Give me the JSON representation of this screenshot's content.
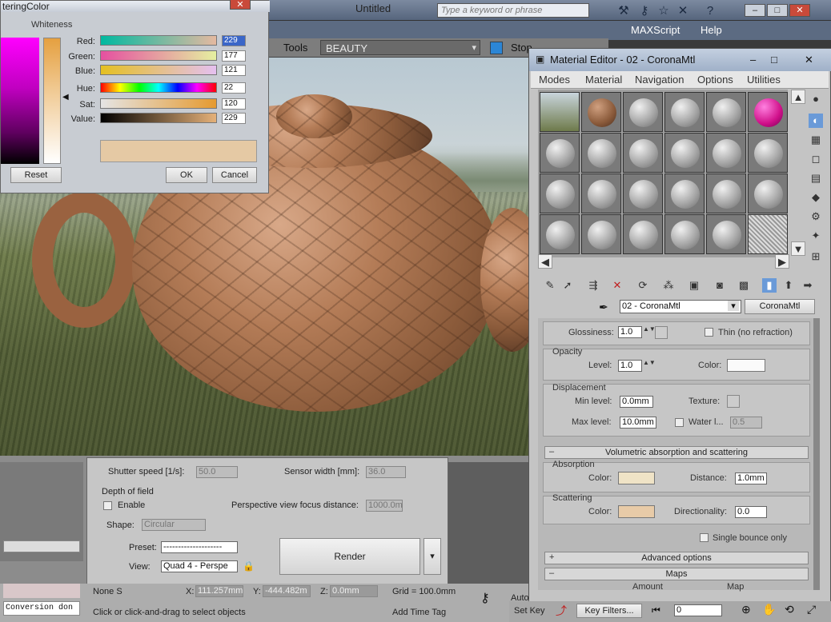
{
  "top": {
    "title": "Untitled",
    "search_placeholder": "Type a keyword or phrase",
    "menu": [
      "MAXScript",
      "Help"
    ]
  },
  "render_window": {
    "tools_label": "Tools",
    "channel": "BEAUTY",
    "stop_label": "Stop",
    "render_label": "Render"
  },
  "color_picker": {
    "title": "teringColor",
    "whiteness_label": "Whiteness",
    "rows": [
      {
        "label": "Red:",
        "value": "229"
      },
      {
        "label": "Green:",
        "value": "177"
      },
      {
        "label": "Blue:",
        "value": "121"
      },
      {
        "label": "Hue:",
        "value": "22"
      },
      {
        "label": "Sat:",
        "value": "120"
      },
      {
        "label": "Value:",
        "value": "229"
      }
    ],
    "preview_color": "#e5c9a4",
    "reset_label": "Reset",
    "ok_label": "OK",
    "cancel_label": "Cancel"
  },
  "render_panel": {
    "shutter_label": "Shutter speed [1/s]:",
    "shutter_value": "50.0",
    "sensor_label": "Sensor width [mm]:",
    "sensor_value": "36.0",
    "dof_label": "Depth of field",
    "enable_label": "Enable",
    "focus_label": "Perspective view focus distance:",
    "focus_value": "1000.0m",
    "shape_label": "Shape:",
    "shape_value": "Circular",
    "preset_label": "Preset:",
    "preset_value": "--------------------",
    "view_label": "View:",
    "view_value": "Quad 4 - Perspe",
    "render_button": "Render"
  },
  "status": {
    "none_label": "None S",
    "x_label": "X:",
    "x_value": "111.257mm",
    "y_label": "Y:",
    "y_value": "-444.482m",
    "z_label": "Z:",
    "z_value": "0.0mm",
    "grid": "Grid = 100.0mm",
    "auto_label": "Auto",
    "set_key": "Set Key",
    "key_filters": "Key Filters...",
    "frame": "0",
    "hint": "Click or click-and-drag to select objects",
    "add_time_tag": "Add Time Tag",
    "conversion": "Conversion don"
  },
  "material_editor": {
    "title": "Material Editor - 02 - CoronaMtl",
    "menu": [
      "Modes",
      "Material",
      "Navigation",
      "Options",
      "Utilities"
    ],
    "material_name": "02 - CoronaMtl",
    "material_type": "CoronaMtl",
    "glossiness_label": "Glossiness:",
    "glossiness_value": "1.0",
    "thin_label": "Thin (no refraction)",
    "opacity_group": "Opacity",
    "level_label": "Level:",
    "level_value": "1.0",
    "color_label": "Color:",
    "displacement_group": "Displacement",
    "min_level_label": "Min level:",
    "min_level_value": "0.0mm",
    "texture_label": "Texture:",
    "max_level_label": "Max level:",
    "max_level_value": "10.0mm",
    "water_label": "Water l...",
    "water_value": "0.5",
    "vol_rollout": "Volumetric absorption and scattering",
    "absorption_group": "Absorption",
    "absorption_color": "#efe3c6",
    "distance_label": "Distance:",
    "distance_value": "1.0mm",
    "scattering_group": "Scattering",
    "scattering_color": "#e8cba8",
    "directionality_label": "Directionality:",
    "directionality_value": "0.0",
    "single_bounce_label": "Single bounce only",
    "advanced_rollout": "Advanced options",
    "maps_rollout": "Maps",
    "amount_label": "Amount",
    "map_label": "Map"
  }
}
